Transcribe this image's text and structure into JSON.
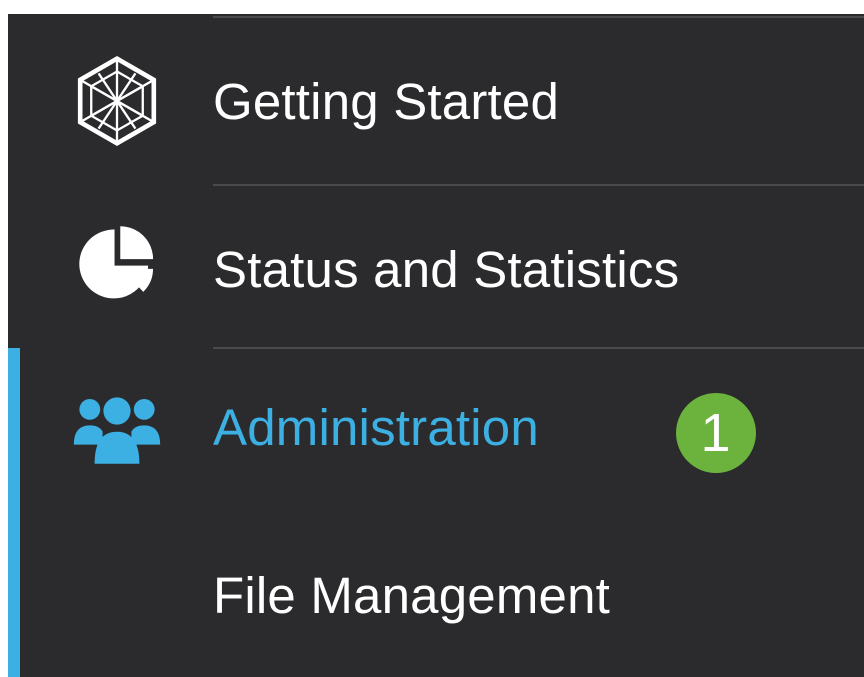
{
  "nav": {
    "items": [
      {
        "label": "Getting Started",
        "icon": "getting-started-icon",
        "active": false
      },
      {
        "label": "Status and Statistics",
        "icon": "pie-chart-icon",
        "active": false
      },
      {
        "label": "Administration",
        "icon": "users-icon",
        "active": true
      },
      {
        "label": "File Management",
        "icon": "",
        "active": false
      }
    ],
    "badge": "1"
  },
  "colors": {
    "background": "#2b2b2d",
    "text": "#ffffff",
    "accent": "#3db0e3",
    "badge": "#6cb33e",
    "divider": "#4a4a4d"
  }
}
